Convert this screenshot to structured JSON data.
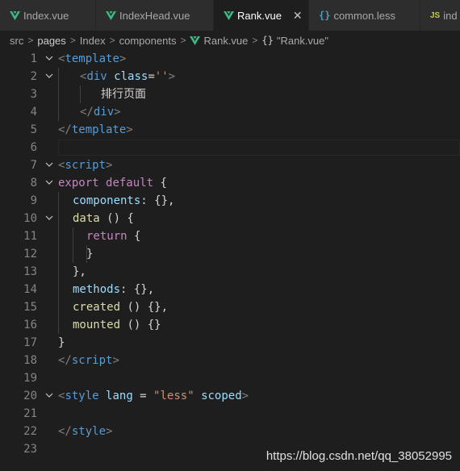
{
  "tabs": [
    {
      "label": "Index.vue",
      "icon": "vue-icon",
      "active": false
    },
    {
      "label": "IndexHead.vue",
      "icon": "vue-icon",
      "active": false
    },
    {
      "label": "Rank.vue",
      "icon": "vue-icon",
      "active": true,
      "close": "✕"
    },
    {
      "label": "common.less",
      "icon": "curly-braces-icon",
      "icon_text": "{}",
      "active": false
    },
    {
      "label": "ind",
      "icon": "js-icon",
      "icon_text": "JS",
      "active": false
    }
  ],
  "breadcrumb": {
    "items": [
      "src",
      "pages",
      "Index",
      "components",
      "Rank.vue",
      "\"Rank.vue\""
    ],
    "separator": ">",
    "symbol": "{}"
  },
  "editor": {
    "line_numbers": [
      "1",
      "2",
      "3",
      "4",
      "5",
      "6",
      "7",
      "8",
      "9",
      "10",
      "11",
      "12",
      "13",
      "14",
      "15",
      "16",
      "17",
      "18",
      "19",
      "20",
      "21",
      "22",
      "23"
    ]
  },
  "colors": {
    "background": "#1e1e1e",
    "vue_green": "#41b883",
    "tag": "#569cd6",
    "attribute": "#9cdcfe",
    "string": "#ce9178",
    "keyword": "#c586c0",
    "function": "#dcdcaa"
  },
  "code": {
    "l1": {
      "open": "<",
      "tag": "template",
      "close": ">"
    },
    "l2": {
      "open": "<",
      "tag": "div",
      "attr": "class",
      "eq": "=",
      "value": "''",
      "close": ">"
    },
    "l3": {
      "text": "排行页面"
    },
    "l4": {
      "open": "</",
      "tag": "div",
      "close": ">"
    },
    "l5": {
      "open": "</",
      "tag": "template",
      "close": ">"
    },
    "l7": {
      "open": "<",
      "tag": "script",
      "close": ">"
    },
    "l8": {
      "kw1": "export",
      "kw2": "default",
      "brace": "{"
    },
    "l9": {
      "prop": "components",
      "rest": ": {},"
    },
    "l10": {
      "fn": "data",
      "rest": " () {"
    },
    "l11": {
      "kw": "return",
      "rest": " {"
    },
    "l12": {
      "rest": "}"
    },
    "l13": {
      "rest": "},"
    },
    "l14": {
      "prop": "methods",
      "rest": ": {},"
    },
    "l15": {
      "fn": "created",
      "rest": " () {},"
    },
    "l16": {
      "fn": "mounted",
      "rest": " () {}"
    },
    "l17": {
      "rest": "}"
    },
    "l18": {
      "open": "</",
      "tag": "script",
      "close": ">"
    },
    "l20": {
      "open": "<",
      "tag": "style",
      "attr1": "lang",
      "eq": " = ",
      "value": "\"less\"",
      "attr2": "scoped",
      "close": ">"
    },
    "l22": {
      "open": "</",
      "tag": "style",
      "close": ">"
    }
  },
  "watermark": "https://blog.csdn.net/qq_38052995"
}
